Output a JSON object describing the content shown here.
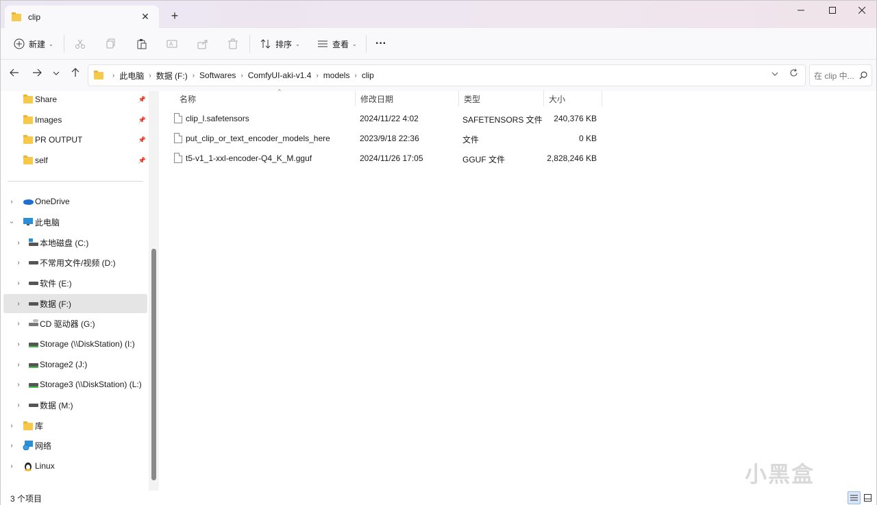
{
  "window": {
    "tab_title": "clip",
    "tab_close": "✕",
    "new_tab": "+",
    "minimize": "─",
    "maximize": "☐",
    "close": "✕"
  },
  "toolbar": {
    "new_label": "新建",
    "sort_label": "排序",
    "view_label": "查看",
    "more_label": "···"
  },
  "address": {
    "crumbs": [
      "此电脑",
      "数据 (F:)",
      "Softwares",
      "ComfyUI-aki-v1.4",
      "models",
      "clip"
    ],
    "search_placeholder": "在 clip 中..."
  },
  "nav": {
    "quick": [
      {
        "label": "Share"
      },
      {
        "label": "Images"
      },
      {
        "label": "PR OUTPUT"
      },
      {
        "label": "self"
      }
    ],
    "onedrive": "OneDrive",
    "thispc": "此电脑",
    "drives": [
      {
        "label": "本地磁盘 (C:)"
      },
      {
        "label": "不常用文件/视频 (D:)"
      },
      {
        "label": "软件 (E:)"
      },
      {
        "label": "数据 (F:)"
      },
      {
        "label": "CD 驱动器 (G:)"
      },
      {
        "label": "Storage (\\\\DiskStation) (I:)"
      },
      {
        "label": "Storage2 (J:)"
      },
      {
        "label": "Storage3 (\\\\DiskStation) (L:)"
      },
      {
        "label": "数据 (M:)"
      }
    ],
    "library": "库",
    "network": "网络",
    "linux": "Linux"
  },
  "columns": {
    "name": "名称",
    "modified": "修改日期",
    "type": "类型",
    "size": "大小"
  },
  "files": [
    {
      "name": "clip_l.safetensors",
      "modified": "2024/11/22 4:02",
      "type": "SAFETENSORS 文件",
      "size": "240,376 KB"
    },
    {
      "name": "put_clip_or_text_encoder_models_here",
      "modified": "2023/9/18 22:36",
      "type": "文件",
      "size": "0 KB"
    },
    {
      "name": "t5-v1_1-xxl-encoder-Q4_K_M.gguf",
      "modified": "2024/11/26 17:05",
      "type": "GGUF 文件",
      "size": "2,828,246 KB"
    }
  ],
  "status": {
    "count": "3 个项目"
  },
  "watermark": "小黑盒",
  "colors": {
    "folder": "#f7c94a",
    "selected": "#e5e5e5",
    "accent": "#0067c0"
  }
}
